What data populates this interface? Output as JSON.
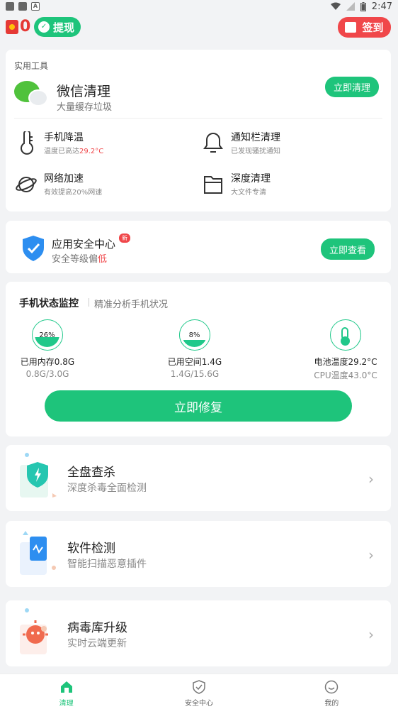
{
  "status_bar": {
    "time": "2:47"
  },
  "top": {
    "coins": "0",
    "withdraw_label": "提现",
    "signin_label": "签到"
  },
  "tools": {
    "section_title": "实用工具",
    "wechat": {
      "title": "微信清理",
      "subtitle": "大量缓存垃圾",
      "button": "立即清理"
    },
    "items": [
      {
        "name": "手机降温",
        "desc_prefix": "温度已高达",
        "desc_value": "29.2°C"
      },
      {
        "name": "通知栏清理",
        "desc": "已发现骚扰通知"
      },
      {
        "name": "网络加速",
        "desc": "有效提高20%网速"
      },
      {
        "name": "深度清理",
        "desc": "大文件专清"
      }
    ]
  },
  "security": {
    "title": "应用安全中心",
    "badge": "新",
    "subtitle_prefix": "安全等级偏",
    "level": "低",
    "button": "立即查看"
  },
  "monitor": {
    "title": "手机状态监控",
    "subtitle": "精准分析手机状况",
    "memory": {
      "percent_label": "26%",
      "percent": 26,
      "main": "已用内存0.8G",
      "sub": "0.8G/3.0G"
    },
    "storage": {
      "percent_label": "8%",
      "percent": 8,
      "main": "已用空间1.4G",
      "sub": "1.4G/15.6G"
    },
    "battery": {
      "main": "电池温度29.2°C",
      "sub": "CPU温度43.0°C"
    },
    "button": "立即修复"
  },
  "features": [
    {
      "name": "全盘查杀",
      "desc": "深度杀毒全面检测",
      "icon": "shield-bolt-icon"
    },
    {
      "name": "软件检测",
      "desc": "智能扫描恶意插件",
      "icon": "phone-scan-icon"
    },
    {
      "name": "病毒库升级",
      "desc": "实时云端更新",
      "icon": "virus-icon"
    }
  ],
  "nav": [
    {
      "label": "清理",
      "active": true
    },
    {
      "label": "安全中心",
      "active": false
    },
    {
      "label": "我的",
      "active": false
    }
  ],
  "colors": {
    "accent": "#1ec47b",
    "warning_red": "#f0474a",
    "warning_yellow": "#f5a400"
  }
}
